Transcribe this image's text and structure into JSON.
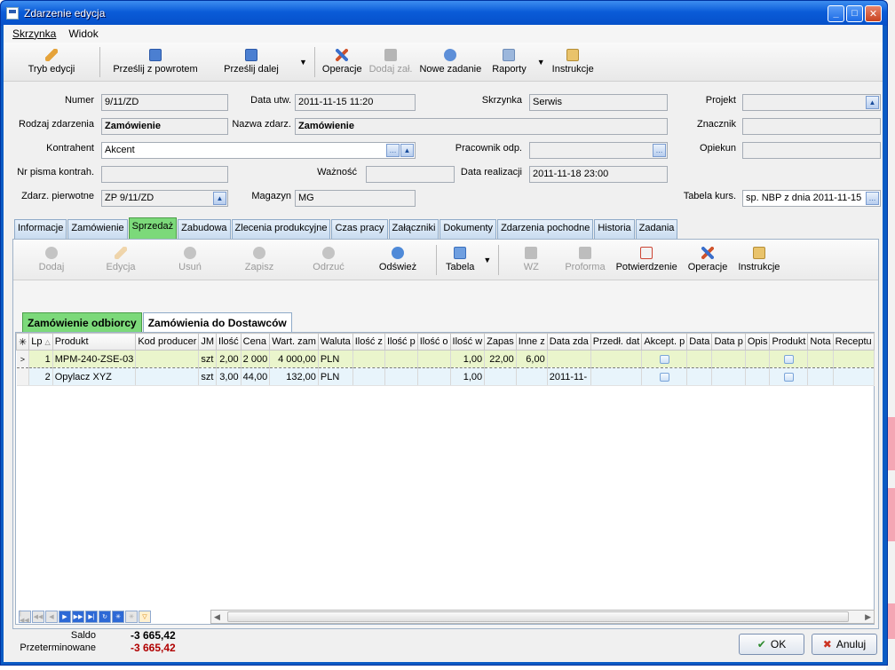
{
  "window": {
    "title": "Zdarzenie edycja"
  },
  "menu": [
    "Skrzynka",
    "Widok"
  ],
  "toolbar": {
    "edit_mode": "Tryb edycji",
    "send_back": "Prześlij z powrotem",
    "send_next": "Prześlij dalej",
    "operations": "Operacje",
    "add_attachment": "Dodaj zał.",
    "new_task": "Nowe zadanie",
    "reports": "Raporty",
    "instructions": "Instrukcje"
  },
  "form": {
    "numer_label": "Numer",
    "numer": "9/11/ZD",
    "data_utw_label": "Data utw.",
    "data_utw": "2011-11-15 11:20",
    "skrzynka_label": "Skrzynka",
    "skrzynka": "Serwis",
    "projekt_label": "Projekt",
    "projekt": "",
    "rodzaj_label": "Rodzaj zdarzenia",
    "rodzaj": "Zamówienie",
    "nazwa_label": "Nazwa zdarz.",
    "nazwa": "Zamówienie",
    "znacznik_label": "Znacznik",
    "znacznik": "",
    "kontrahent_label": "Kontrahent",
    "kontrahent": "Akcent",
    "pracownik_label": "Pracownik odp.",
    "pracownik": "",
    "opiekun_label": "Opiekun",
    "opiekun": "",
    "nr_pisma_label": "Nr pisma kontrah.",
    "nr_pisma": "",
    "waznosc_label": "Ważność",
    "waznosc": "",
    "data_realizacji_label": "Data realizacji",
    "data_realizacji": "2011-11-18 23:00",
    "pierwotne_label": "Zdarz. pierwotne",
    "pierwotne": "ZP 9/11/ZD",
    "magazyn_label": "Magazyn",
    "magazyn": "MG",
    "tabela_kurs_label": "Tabela kurs.",
    "tabela_kurs": "sp. NBP z dnia 2011-11-15"
  },
  "tabs": [
    "Informacje",
    "Zamówienie",
    "Sprzedaż",
    "Zabudowa",
    "Zlecenia produkcyjne",
    "Czas pracy",
    "Załączniki",
    "Dokumenty",
    "Zdarzenia pochodne",
    "Historia",
    "Zadania"
  ],
  "active_tab": "Sprzedaż",
  "panel_toolbar": {
    "add": "Dodaj",
    "edit": "Edycja",
    "delete": "Usuń",
    "save": "Zapisz",
    "reject": "Odrzuć",
    "refresh": "Odśwież",
    "table": "Tabela",
    "wz": "WZ",
    "proforma": "Proforma",
    "confirmation": "Potwierdzenie",
    "operations": "Operacje",
    "instructions": "Instrukcje"
  },
  "subtabs": [
    "Zamówienie odbiorcy",
    "Zamówienia do Dostawców"
  ],
  "grid": {
    "columns": [
      "Lp",
      "Produkt",
      "Kod producer",
      "JM",
      "Ilość",
      "Cena",
      "Wart. zam",
      "Waluta",
      "Ilość z",
      "Ilość p",
      "Ilość o",
      "Ilość w",
      "Zapas",
      "Inne z",
      "Data zda",
      "Przedł. dat",
      "Akcept. p",
      "Data",
      "Data p",
      "Opis",
      "Produkt",
      "Nota",
      "Receptu"
    ],
    "rows": [
      {
        "lp": "1",
        "produkt": "MPM-240-ZSE-03",
        "kod": "",
        "jm": "szt",
        "ilosc": "2,00",
        "cena": "2 000",
        "wart": "4 000,00",
        "waluta": "PLN",
        "ilosc_w": "1,00",
        "zapas": "22,00",
        "inne": "6,00",
        "data_zda": ""
      },
      {
        "lp": "2",
        "produkt": "Opylacz XYZ",
        "kod": "",
        "jm": "szt",
        "ilosc": "3,00",
        "cena": "44,00",
        "wart": "132,00",
        "waluta": "PLN",
        "ilosc_w": "1,00",
        "zapas": "",
        "inne": "",
        "data_zda": "2011-11-"
      }
    ]
  },
  "footer": {
    "saldo_label": "Saldo",
    "saldo": "-3 665,42",
    "przeterminowane_label": "Przeterminowane",
    "przeterminowane": "-3 665,42",
    "ok": "OK",
    "cancel": "Anuluj"
  }
}
